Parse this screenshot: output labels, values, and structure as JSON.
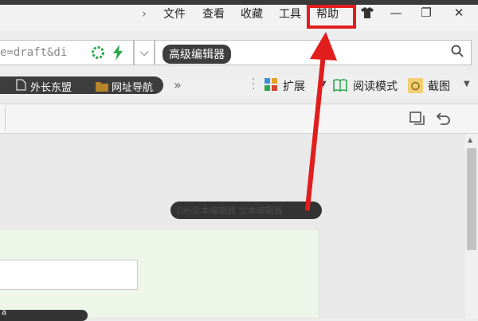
{
  "menu": {
    "items": [
      "文件",
      "查看",
      "收藏",
      "工具",
      "帮助"
    ]
  },
  "window_controls": {
    "skin": "skin-icon",
    "minimize": "—",
    "maximize": "❐",
    "close": "✕"
  },
  "address": {
    "url_fragment": "e=draft&di",
    "dropdown": "⌵",
    "search_text": "高级编辑器"
  },
  "bookmarks": [
    {
      "label": "外长东盟"
    },
    {
      "label": "网址导航"
    }
  ],
  "toolbar": {
    "more": "»",
    "extensions": "扩展",
    "reading_mode": "阅读模式",
    "screenshot": "截图"
  },
  "content": {
    "redacted_text": "Dm文本编辑器  文本编辑器",
    "redacted_text2": "a"
  },
  "colors": {
    "annotation": "#e11d1d",
    "accent_green": "#2aa84a"
  }
}
